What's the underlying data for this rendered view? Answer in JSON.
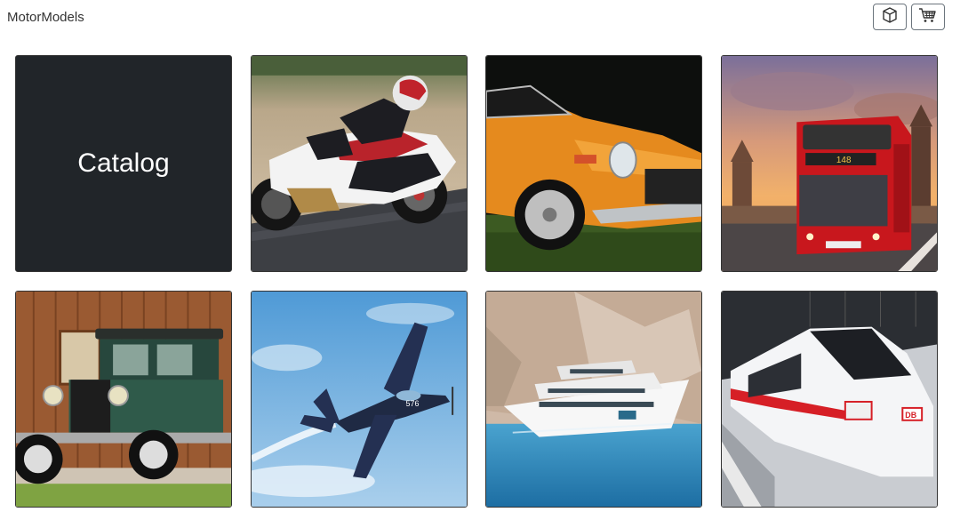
{
  "header": {
    "brand": "MotorModels",
    "icons": [
      "box-icon",
      "cart-icon"
    ]
  },
  "grid": {
    "catalog_label": "Catalog",
    "tiles": [
      {
        "subject": "motorcycle",
        "bus_sign": ""
      },
      {
        "subject": "sports-car"
      },
      {
        "subject": "double-decker-bus",
        "bus_sign": "148"
      },
      {
        "subject": "vintage-car"
      },
      {
        "subject": "airplane",
        "plane_mark": "576"
      },
      {
        "subject": "yacht"
      },
      {
        "subject": "train",
        "train_logo": "DB"
      }
    ]
  }
}
